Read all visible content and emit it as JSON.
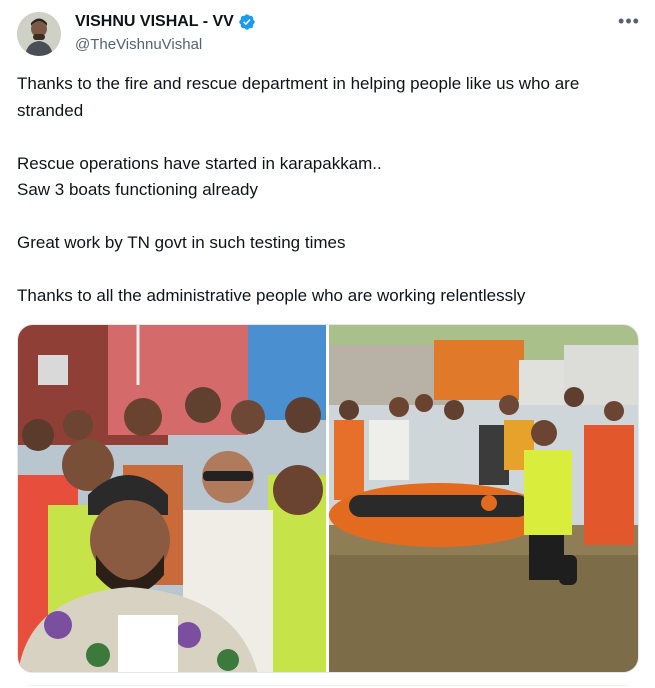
{
  "author": {
    "display_name": "VISHNU VISHAL - VV",
    "handle": "@TheVishnuVishal",
    "verified": true,
    "verified_color": "#1d9bf0",
    "avatar_icon": "user-avatar"
  },
  "tweet": {
    "paragraphs": [
      "Thanks to the fire and rescue department in helping people like us who are stranded",
      "Rescue operations have started in karapakkam..",
      "Saw 3 boats functioning already",
      "Great work by TN govt in such testing times",
      "Thanks to all the administrative people who are working relentlessly"
    ]
  },
  "menu": {
    "icon": "more-horizontal-icon",
    "glyph": "•••"
  },
  "media": {
    "count": 2,
    "images": [
      {
        "icon": "group-selfie-photo"
      },
      {
        "icon": "rescue-boat-photo"
      }
    ]
  }
}
